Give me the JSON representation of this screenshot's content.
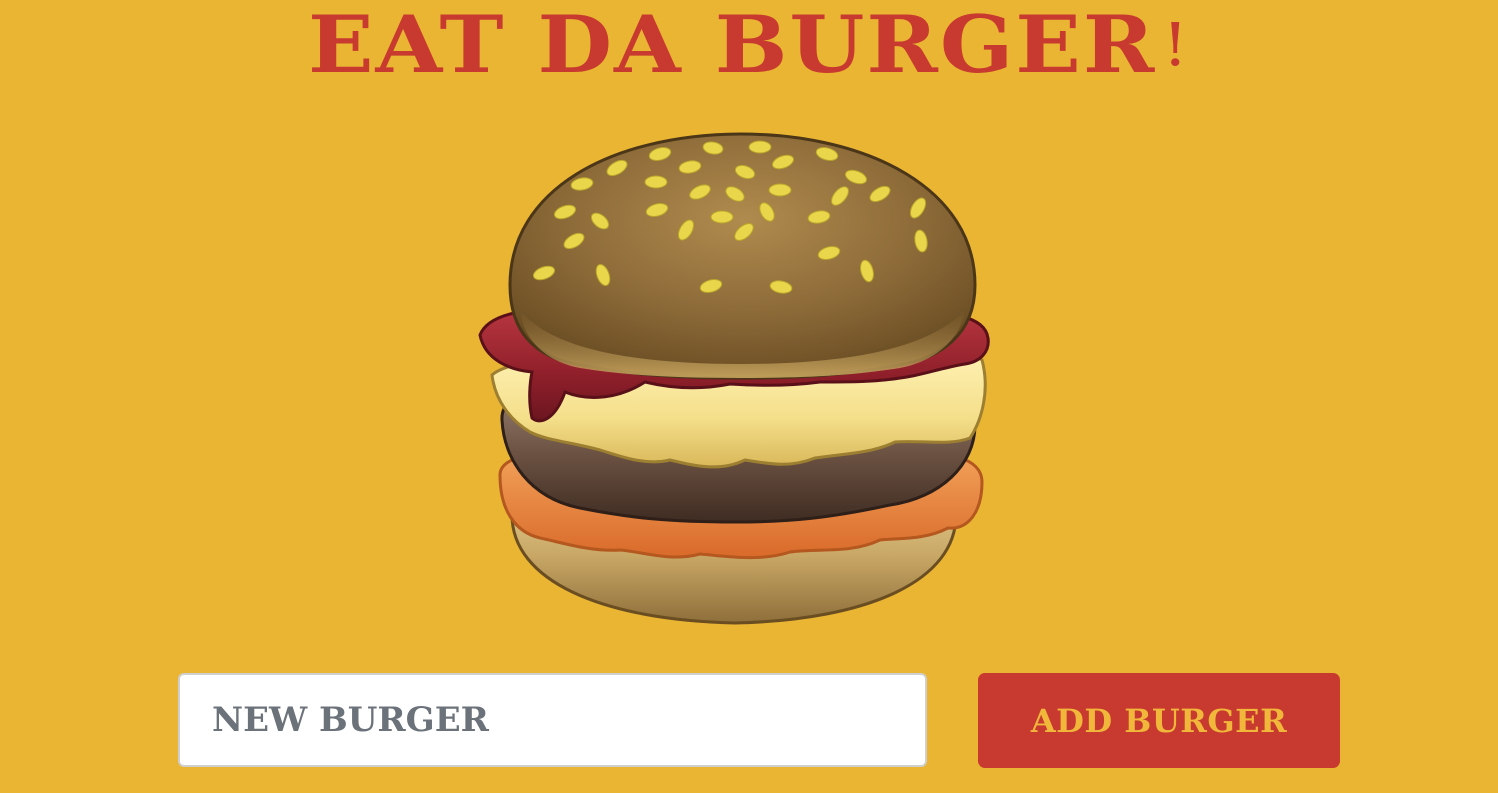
{
  "header": {
    "title": "EAT DA BURGER",
    "exclamation": "!"
  },
  "hero": {
    "image_name": "burger-illustration"
  },
  "form": {
    "input_placeholder": "NEW BURGER",
    "input_value": "",
    "submit_label": "ADD BURGER"
  },
  "colors": {
    "background": "#eab533",
    "brand_red": "#c83a2f",
    "button_text": "#f0b73a",
    "input_text": "#6b7279"
  }
}
